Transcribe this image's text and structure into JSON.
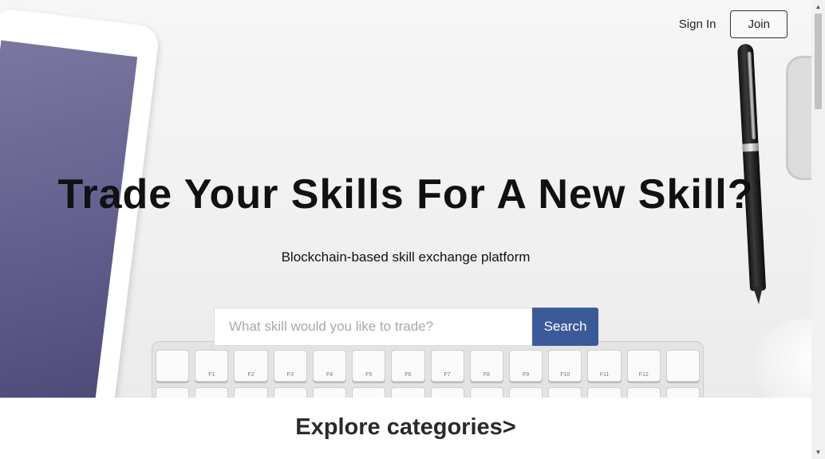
{
  "nav": {
    "signin_label": "Sign In",
    "join_label": "Join"
  },
  "hero": {
    "headline": "Trade Your Skills For A New Skill?",
    "subtitle": "Blockchain-based skill exchange platform"
  },
  "search": {
    "placeholder": "What skill would you like to trade?",
    "value": "",
    "button_label": "Search"
  },
  "explore": {
    "heading": "Explore categories>"
  },
  "keyboard": {
    "row1": [
      "",
      "F1",
      "F2",
      "F3",
      "F4",
      "F5",
      "F6",
      "F7",
      "F8",
      "F9",
      "F10",
      "F11",
      "F12",
      ""
    ],
    "row2": [
      "~",
      "!",
      "@",
      "#",
      "$",
      "%",
      "^",
      "&",
      "*",
      "(",
      ")",
      "_",
      "+",
      ""
    ]
  },
  "colors": {
    "search_button": "#3a5a9a",
    "ipad_screen": "#5e5b8a"
  },
  "icons": {
    "scroll_up": "triangle-up-icon",
    "scroll_down": "triangle-down-icon"
  }
}
